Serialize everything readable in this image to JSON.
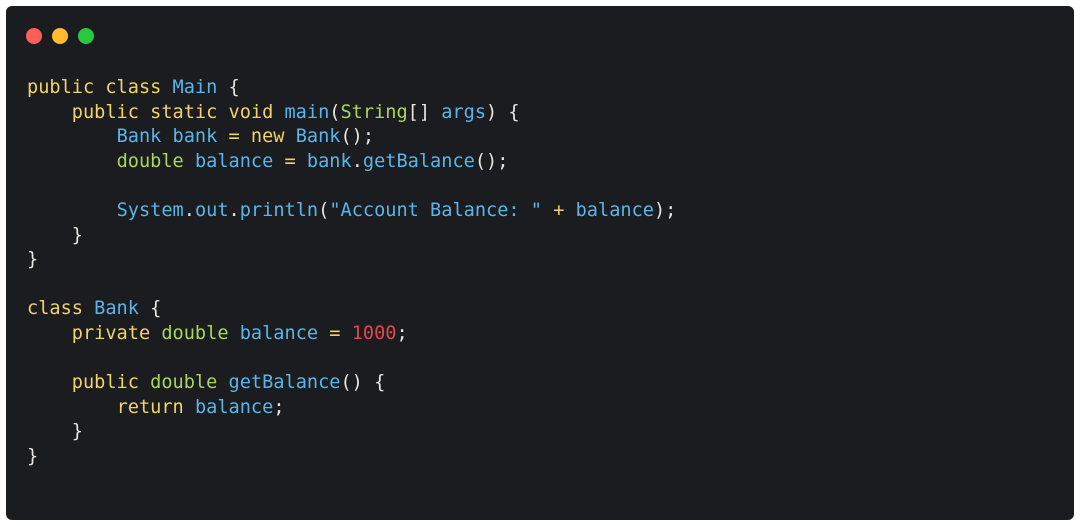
{
  "window": {
    "controls": [
      {
        "name": "close-dot",
        "color": "#ff5f57"
      },
      {
        "name": "minimize-dot",
        "color": "#febc2e"
      },
      {
        "name": "maximize-dot",
        "color": "#28c840"
      }
    ]
  },
  "colors": {
    "background": "#1b1c1f",
    "keyword": "#f0d36a",
    "type": "#a8d65f",
    "identifier": "#5bb5e8",
    "number": "#e0474c",
    "plain": "#e8e6df"
  },
  "code_lines": [
    [
      [
        "public class ",
        "keyword"
      ],
      [
        "Main",
        "identifier"
      ],
      [
        " {",
        "plain"
      ]
    ],
    [
      [
        "    ",
        "plain"
      ],
      [
        "public static void ",
        "keyword"
      ],
      [
        "main",
        "identifier"
      ],
      [
        "(",
        "plain"
      ],
      [
        "String",
        "type"
      ],
      [
        "[] ",
        "plain"
      ],
      [
        "args",
        "identifier"
      ],
      [
        ") {",
        "plain"
      ]
    ],
    [
      [
        "        ",
        "plain"
      ],
      [
        "Bank bank",
        "identifier"
      ],
      [
        " = ",
        "keyword"
      ],
      [
        "new ",
        "keyword"
      ],
      [
        "Bank",
        "identifier"
      ],
      [
        "();",
        "plain"
      ]
    ],
    [
      [
        "        ",
        "plain"
      ],
      [
        "double ",
        "type"
      ],
      [
        "balance",
        "identifier"
      ],
      [
        " = ",
        "keyword"
      ],
      [
        "bank",
        "identifier"
      ],
      [
        ".",
        "plain"
      ],
      [
        "getBalance",
        "identifier"
      ],
      [
        "();",
        "plain"
      ]
    ],
    [
      [
        "",
        "plain"
      ]
    ],
    [
      [
        "        ",
        "plain"
      ],
      [
        "System",
        "identifier"
      ],
      [
        ".",
        "plain"
      ],
      [
        "out",
        "identifier"
      ],
      [
        ".",
        "plain"
      ],
      [
        "println",
        "identifier"
      ],
      [
        "(",
        "plain"
      ],
      [
        "\"Account Balance: \"",
        "identifier"
      ],
      [
        " + ",
        "keyword"
      ],
      [
        "balance",
        "identifier"
      ],
      [
        ");",
        "plain"
      ]
    ],
    [
      [
        "    }",
        "plain"
      ]
    ],
    [
      [
        "}",
        "plain"
      ]
    ],
    [
      [
        "",
        "plain"
      ]
    ],
    [
      [
        "class ",
        "keyword"
      ],
      [
        "Bank",
        "identifier"
      ],
      [
        " {",
        "plain"
      ]
    ],
    [
      [
        "    ",
        "plain"
      ],
      [
        "private ",
        "keyword"
      ],
      [
        "double ",
        "type"
      ],
      [
        "balance",
        "identifier"
      ],
      [
        " = ",
        "keyword"
      ],
      [
        "1000",
        "number"
      ],
      [
        ";",
        "plain"
      ]
    ],
    [
      [
        "",
        "plain"
      ]
    ],
    [
      [
        "    ",
        "plain"
      ],
      [
        "public ",
        "keyword"
      ],
      [
        "double ",
        "type"
      ],
      [
        "getBalance",
        "identifier"
      ],
      [
        "() {",
        "plain"
      ]
    ],
    [
      [
        "        ",
        "plain"
      ],
      [
        "return ",
        "keyword"
      ],
      [
        "balance",
        "identifier"
      ],
      [
        ";",
        "plain"
      ]
    ],
    [
      [
        "    }",
        "plain"
      ]
    ],
    [
      [
        "}",
        "plain"
      ]
    ]
  ]
}
